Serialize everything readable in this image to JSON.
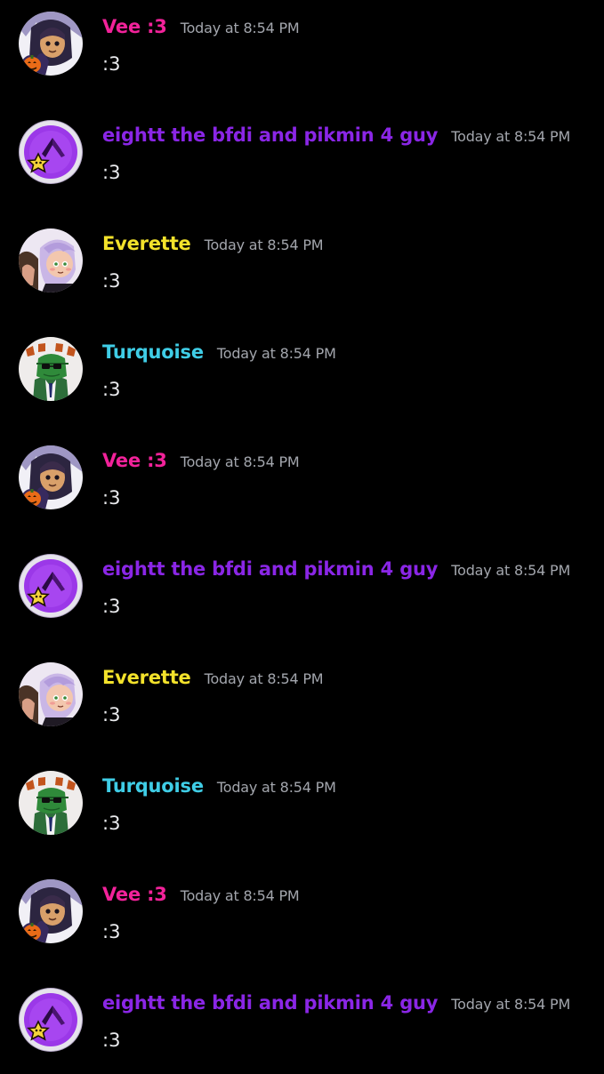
{
  "channel": {
    "messages": [
      {
        "author": "Vee :3",
        "author_color": "#f2229a",
        "avatar_icon": "vee-avatar-icon",
        "timestamp": "Today at 8:54 PM",
        "content": ":3"
      },
      {
        "author": "eightt the bfdi and pikmin 4 guy",
        "author_color": "#8a26e6",
        "avatar_icon": "eightt-avatar-icon",
        "timestamp": "Today at 8:54 PM",
        "content": ":3"
      },
      {
        "author": "Everette",
        "author_color": "#f3e22b",
        "avatar_icon": "everette-avatar-icon",
        "timestamp": "Today at 8:54 PM",
        "content": ":3"
      },
      {
        "author": "Turquoise",
        "author_color": "#3fcde6",
        "avatar_icon": "turquoise-avatar-icon",
        "timestamp": "Today at 8:54 PM",
        "content": ":3"
      },
      {
        "author": "Vee :3",
        "author_color": "#f2229a",
        "avatar_icon": "vee-avatar-icon",
        "timestamp": "Today at 8:54 PM",
        "content": ":3"
      },
      {
        "author": "eightt the bfdi and pikmin 4 guy",
        "author_color": "#8a26e6",
        "avatar_icon": "eightt-avatar-icon",
        "timestamp": "Today at 8:54 PM",
        "content": ":3"
      },
      {
        "author": "Everette",
        "author_color": "#f3e22b",
        "avatar_icon": "everette-avatar-icon",
        "timestamp": "Today at 8:54 PM",
        "content": ":3"
      },
      {
        "author": "Turquoise",
        "author_color": "#3fcde6",
        "avatar_icon": "turquoise-avatar-icon",
        "timestamp": "Today at 8:54 PM",
        "content": ":3"
      },
      {
        "author": "Vee :3",
        "author_color": "#f2229a",
        "avatar_icon": "vee-avatar-icon",
        "timestamp": "Today at 8:54 PM",
        "content": ":3"
      },
      {
        "author": "eightt the bfdi and pikmin 4 guy",
        "author_color": "#8a26e6",
        "avatar_icon": "eightt-avatar-icon",
        "timestamp": "Today at 8:54 PM",
        "content": ":3"
      }
    ]
  },
  "theme": {
    "background": "#000000",
    "timestamp_color": "#a3a6ad",
    "text_color": "#e9eaed"
  }
}
